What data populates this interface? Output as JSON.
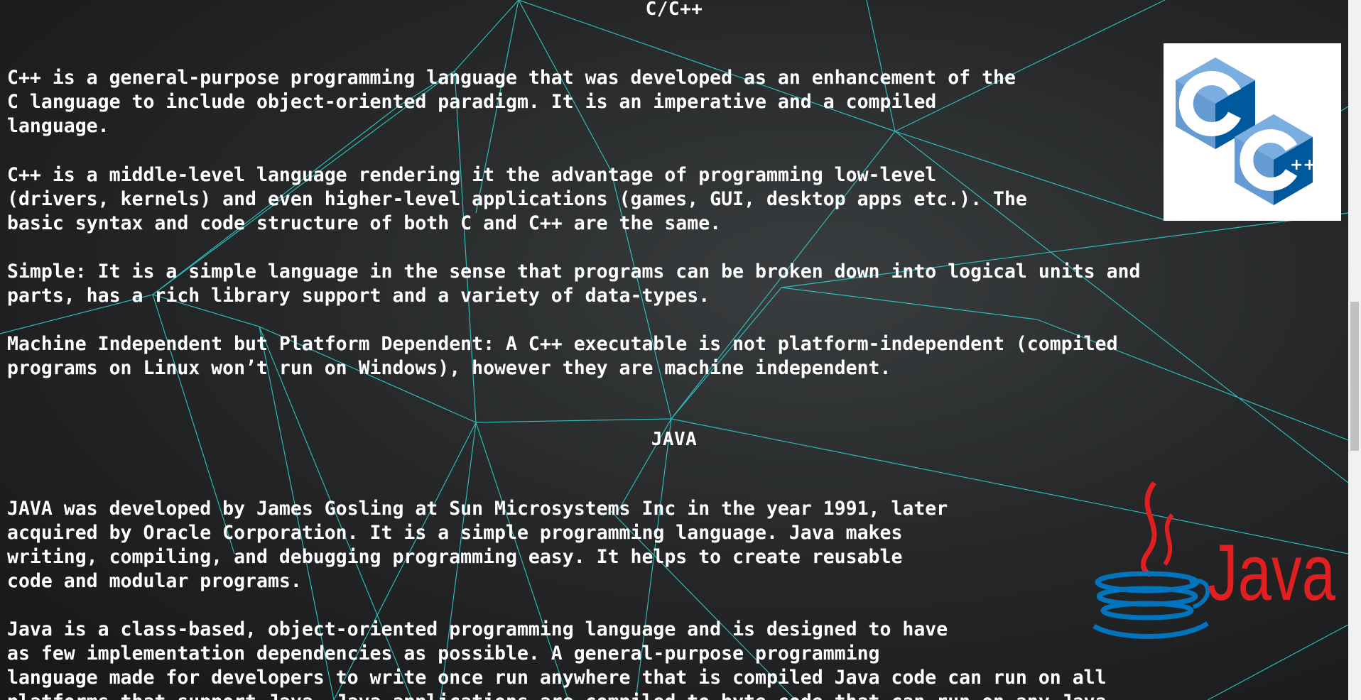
{
  "sections": {
    "cpp": {
      "title": "C/C++",
      "paragraphs": [
        "C++ is a general-purpose programming language that was developed as an enhancement of the\nC language to include object-oriented paradigm. It is an imperative and a compiled\nlanguage.",
        "C++ is a middle-level language rendering it the advantage of programming low-level\n(drivers, kernels) and even higher-level applications (games, GUI, desktop apps etc.). The\nbasic syntax and code structure of both C and C++ are the same.",
        "Simple: It is a simple language in the sense that programs can be broken down into logical units and\nparts, has a rich library support and a variety of data-types.",
        "Machine Independent but Platform Dependent: A C++ executable is not platform-independent (compiled\nprograms on Linux won’t run on Windows), however they are machine independent."
      ],
      "logo_icon": "cpp-logo"
    },
    "java": {
      "title": "JAVA",
      "paragraphs": [
        "JAVA was developed by James Gosling at Sun Microsystems Inc in the year 1991, later\nacquired by Oracle Corporation. It is a simple programming language. Java makes\nwriting, compiling, and debugging programming easy. It helps to create reusable\ncode and modular programs.",
        "Java is a class-based, object-oriented programming language and is designed to have\nas few implementation dependencies as possible. A general-purpose programming\nlanguage made for developers to write once run anywhere that is compiled Java code can run on all\nplatforms that support Java. Java applications are compiled to byte code that can run on any Java"
      ],
      "logo_icon": "java-logo",
      "logo_text": "Java"
    }
  },
  "colors": {
    "background": "#1e1f20",
    "network_lines": "#2fd3d3",
    "text": "#ffffff",
    "cpp_blue_dark": "#00599c",
    "cpp_blue_light": "#659ad2",
    "java_red": "#e11f21",
    "java_blue": "#0074bd"
  }
}
